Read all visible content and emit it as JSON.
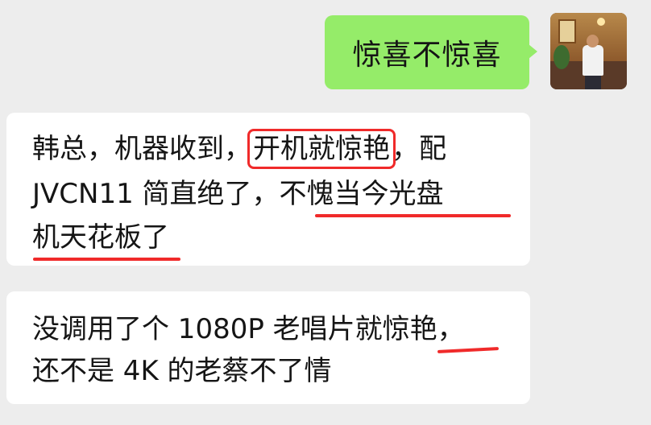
{
  "outgoing_message": {
    "text": "惊喜不惊喜"
  },
  "incoming_messages": [
    {
      "lines": [
        {
          "parts": [
            "韩总，机器收到，",
            "开机就惊艳",
            "，配"
          ]
        },
        {
          "parts": [
            "JVCN11 简直绝了，",
            "不愧当今光盘"
          ]
        },
        {
          "parts": [
            "机天花板了"
          ]
        }
      ]
    },
    {
      "lines": [
        {
          "parts": [
            "没调用了个 1080P 老唱片就",
            "惊艳",
            "，"
          ]
        },
        {
          "parts": [
            "还不是 4K 的老蔡不了情"
          ]
        }
      ]
    }
  ],
  "annotation_color": "#f02a2a",
  "outgoing_bubble_color": "#95ec69",
  "incoming_bubble_color": "#ffffff",
  "background_color": "#ededed"
}
